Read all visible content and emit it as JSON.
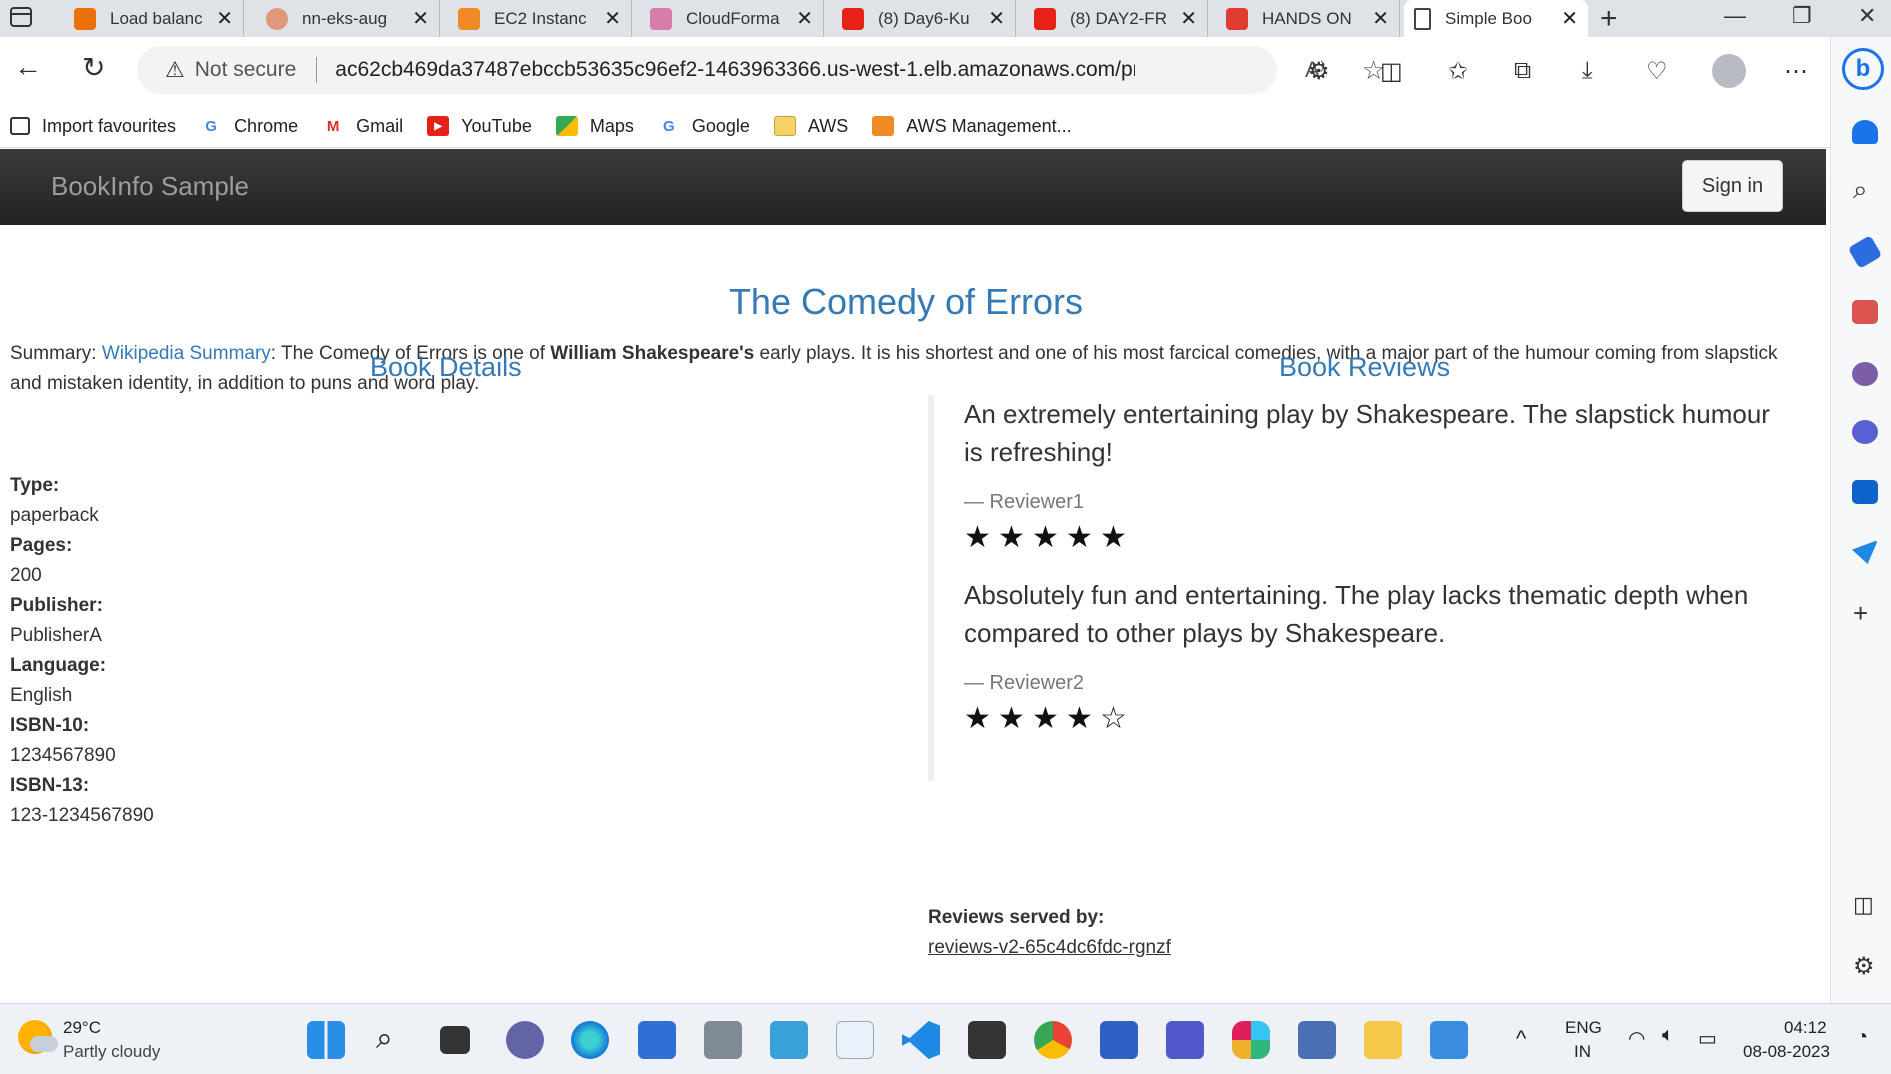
{
  "browser": {
    "tabs": [
      {
        "label": "Load balanc",
        "color": "#e8710a"
      },
      {
        "label": "nn-eks-aug",
        "color": "#e0977a"
      },
      {
        "label": "EC2 Instanc",
        "color": "#f08a24"
      },
      {
        "label": "CloudForma",
        "color": "#d87cab"
      },
      {
        "label": "(8) Day6-Ku",
        "color": "#e62117"
      },
      {
        "label": "(8) DAY2-FR",
        "color": "#e62117"
      },
      {
        "label": "HANDS ON",
        "color": "#e03c31"
      },
      {
        "label": "Simple Boo",
        "color": "#ffffff"
      }
    ],
    "address": {
      "security": "Not secure",
      "url": "ac62cb469da37487ebccb53635c96ef2-1463963366.us-west-1.elb.amazonaws.com/pr..."
    },
    "bookmarks": [
      {
        "label": "Import favourites",
        "icon": "import-icon"
      },
      {
        "label": "Chrome",
        "icon": "google-icon"
      },
      {
        "label": "Gmail",
        "icon": "gmail-icon"
      },
      {
        "label": "YouTube",
        "icon": "youtube-icon"
      },
      {
        "label": "Maps",
        "icon": "maps-icon"
      },
      {
        "label": "Google",
        "icon": "google-icon"
      },
      {
        "label": "AWS",
        "icon": "folder-icon"
      },
      {
        "label": "AWS Management...",
        "icon": "aws-icon"
      }
    ]
  },
  "app": {
    "brand": "BookInfo Sample",
    "signin": "Sign in",
    "title": "The Comedy of Errors",
    "summary": {
      "prefix": "Summary: ",
      "link": "Wikipedia Summary",
      "text1": ": The Comedy of Errors is one of ",
      "bold": "William Shakespeare's",
      "text2": " early plays. It is his shortest and one of his most farcical comedies, with a major part of the humour coming from slapstick and mistaken identity, in addition to puns and word play."
    },
    "details_heading": "Book Details",
    "reviews_heading": "Book Reviews",
    "details": [
      {
        "label": "Type:",
        "value": "paperback"
      },
      {
        "label": "Pages:",
        "value": "200"
      },
      {
        "label": "Publisher:",
        "value": "PublisherA"
      },
      {
        "label": "Language:",
        "value": "English"
      },
      {
        "label": "ISBN-10:",
        "value": "1234567890"
      },
      {
        "label": "ISBN-13:",
        "value": "123-1234567890"
      }
    ],
    "reviews": [
      {
        "text": "An extremely entertaining play by Shakespeare. The slapstick humour is refreshing!",
        "reviewer": "— Reviewer1",
        "rating": 5
      },
      {
        "text": "Absolutely fun and entertaining. The play lacks thematic depth when compared to other plays by Shakespeare.",
        "reviewer": "— Reviewer2",
        "rating": 4
      }
    ],
    "served_by_label": "Reviews served by:",
    "served_by": "reviews-v2-65c4dc6fdc-rgnzf"
  },
  "taskbar": {
    "temperature": "29°C",
    "condition": "Partly cloudy",
    "language": "ENG",
    "region": "IN",
    "time": "04:12",
    "date": "08-08-2023"
  }
}
